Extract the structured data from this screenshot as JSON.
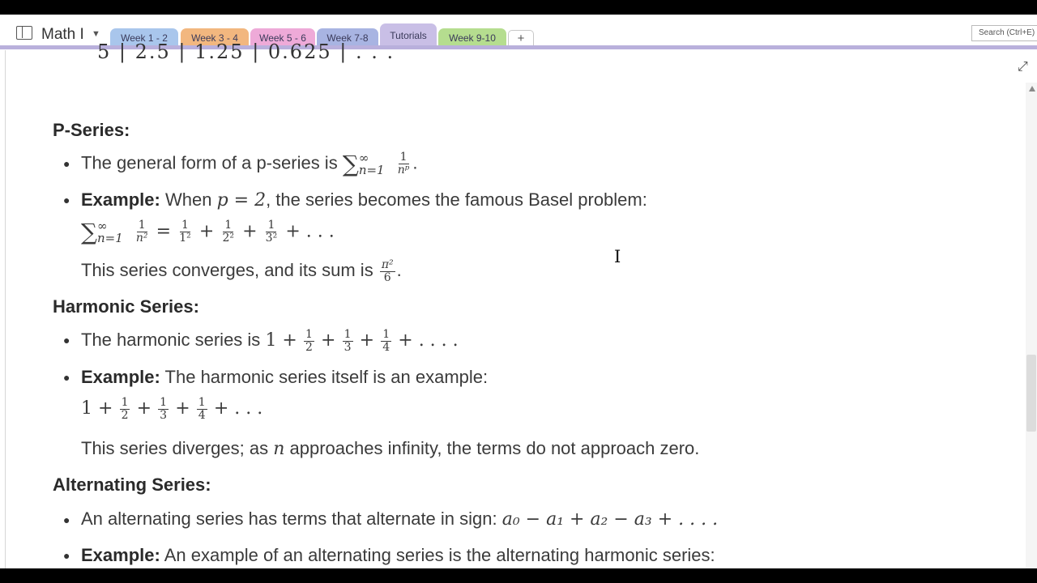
{
  "notebook": {
    "title": "Math I"
  },
  "tabs": [
    {
      "label": "Week 1 - 2"
    },
    {
      "label": "Week 3 - 4"
    },
    {
      "label": "Week 5 - 6"
    },
    {
      "label": "Week 7-8"
    },
    {
      "label": "Tutorials"
    },
    {
      "label": "Week 9-10"
    }
  ],
  "add_tab_label": "+",
  "search": {
    "placeholder": "Search (Ctrl+E)"
  },
  "colors": {
    "tab_week12": "#a9c6ec",
    "tab_week34": "#f2b77f",
    "tab_week56": "#eeaad8",
    "tab_week78": "#a8b4e2",
    "tab_tutorials": "#c9bfe6",
    "tab_week910": "#b5dd8f",
    "accent": "#b9b0dc"
  },
  "partial_row": "5  |  2.5  |  1.25  |  0.625  |  . . .",
  "sections": {
    "p_series": {
      "heading": "P-Series:",
      "b1_text": "The general form of a p-series is",
      "b1_sum_sup": "∞",
      "b1_sum_sub": "n=1",
      "b1_frac_num": "1",
      "b1_frac_den": "nᵖ",
      "b2_label": "Example:",
      "b2_text1": "When",
      "b2_math": "p = 2",
      "b2_text2": ", the series becomes the famous Basel problem:",
      "basel_rhs": "+ . . .",
      "basel_den1": "1²",
      "basel_den2": "2²",
      "basel_den3": "3²",
      "basel_den0": "n²",
      "converge_text": "This series converges, and its sum is",
      "sum_num": "π²",
      "sum_den": "6"
    },
    "harmonic": {
      "heading": "Harmonic Series:",
      "b1_text": "The harmonic series is",
      "b2_label": "Example:",
      "b2_text": "The harmonic series itself is an example:",
      "diverge_text1": "This series diverges; as",
      "diverge_var": "n",
      "diverge_text2": "approaches infinity, the terms do not approach zero."
    },
    "alternating": {
      "heading": "Alternating Series:",
      "b1_text": "An alternating series has terms that alternate in sign:",
      "b1_math": "a₀ − a₁ + a₂ − a₃ + . . . .",
      "b2_label": "Example:",
      "b2_text": "An example of an alternating series is the alternating harmonic series:"
    }
  }
}
